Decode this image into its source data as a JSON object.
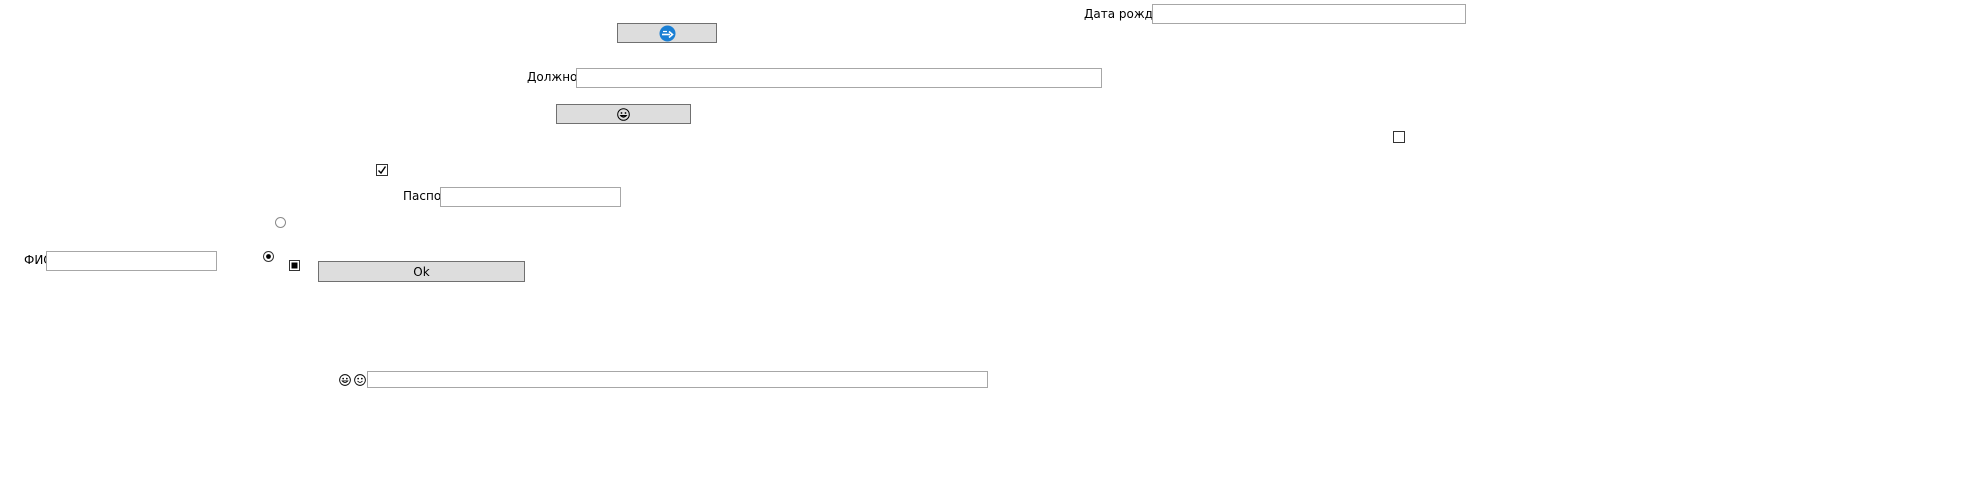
{
  "form": {
    "birth_date_label": "Дата рождения",
    "birth_date_value": "",
    "position_label": "Должность",
    "position_value": "",
    "passport_label": "Паспорт",
    "passport_value": "",
    "fio_label": "ФИО",
    "fio_value": "",
    "bottom_input_value": ""
  },
  "buttons": {
    "top_icon_button_icon": "circle-arrow-icon",
    "emoji_button_icon": "grinning-face-icon",
    "ok_label": "Ok"
  },
  "controls": {
    "checkbox_right_checked": false,
    "checkbox_left_checked": true,
    "radio_top_selected": false,
    "radio_bottom_selected": true,
    "square_toggle_filled": true
  },
  "bottom_icons": [
    "grinning-face-icon",
    "smiling-face-icon"
  ],
  "colors": {
    "button_bg": "#dddddd",
    "button_border": "#707070",
    "field_border": "#a7a7a7",
    "accent_blue": "#1a7fd4"
  }
}
